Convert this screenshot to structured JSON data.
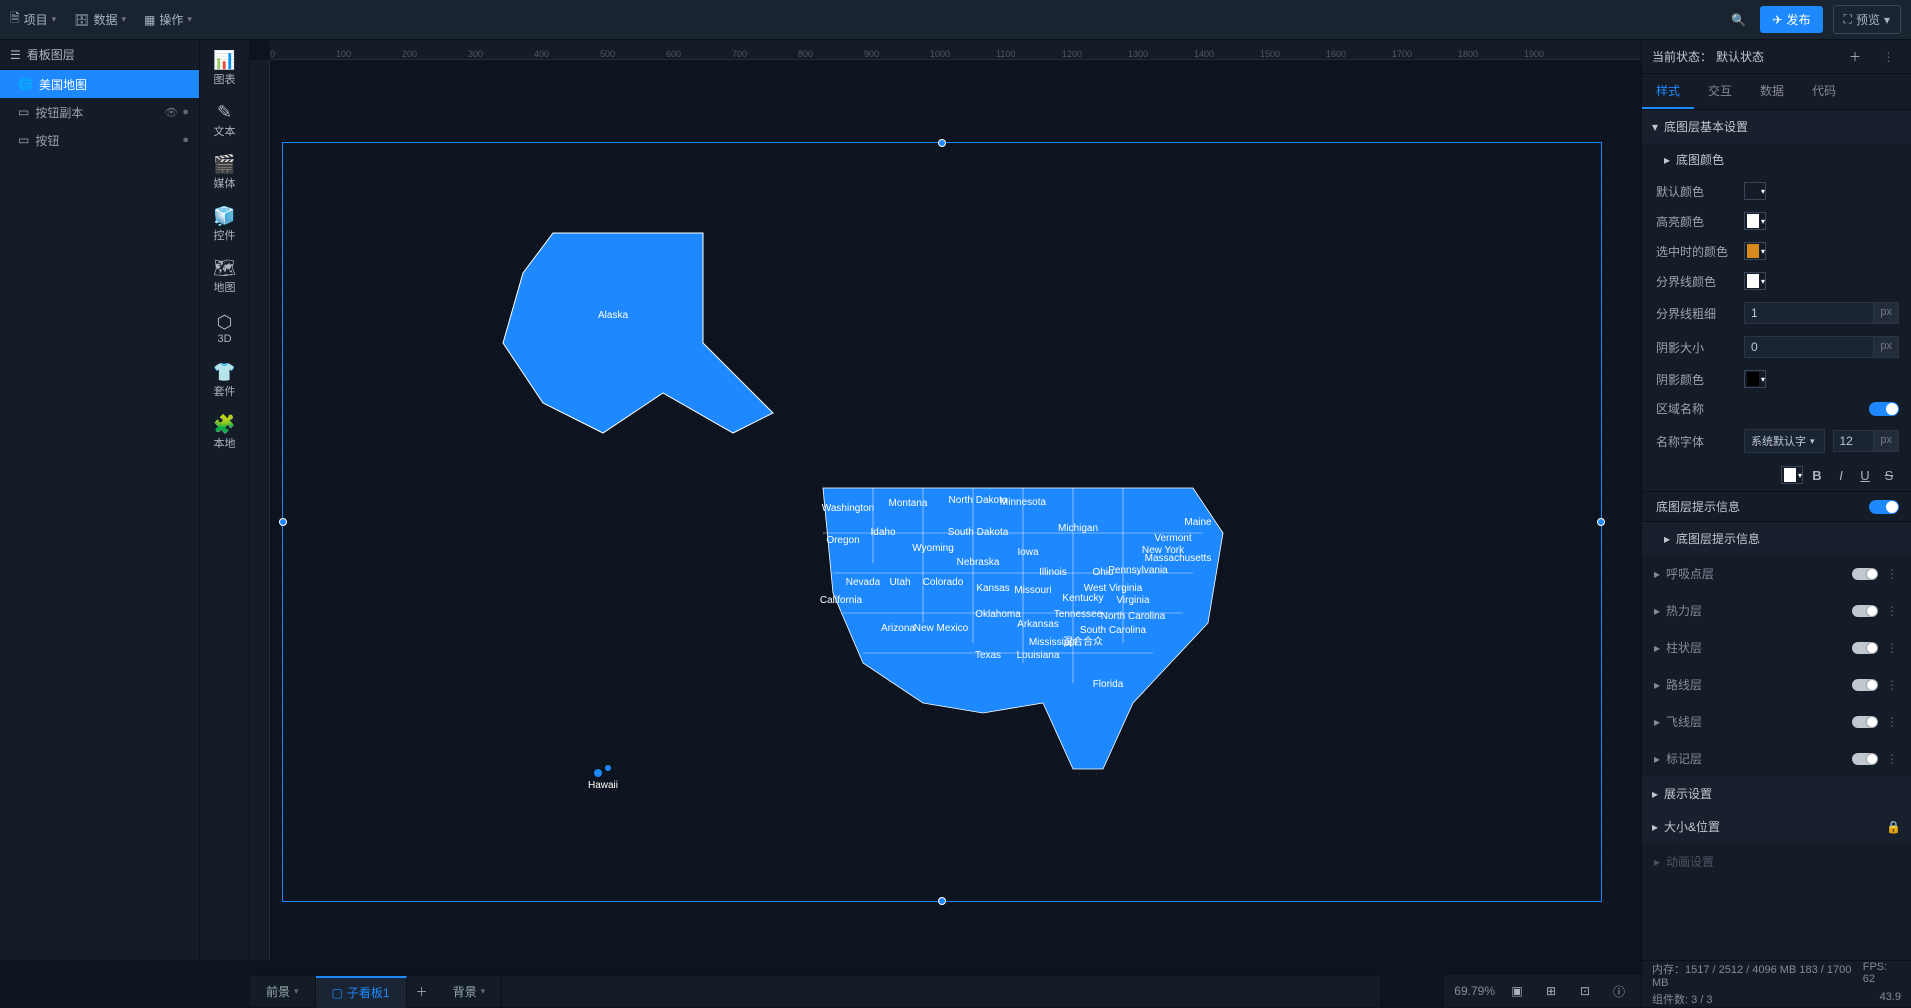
{
  "topbar": {
    "menu_project": "项目",
    "menu_data": "数据",
    "menu_operate": "操作",
    "publish": "发布",
    "preview": "预览"
  },
  "leftpanel": {
    "header": "看板图层",
    "layers": [
      {
        "name": "美国地图",
        "active": true
      },
      {
        "name": "按钮副本",
        "active": false,
        "has_icons": true
      },
      {
        "name": "按钮",
        "active": false,
        "has_icon": true
      }
    ]
  },
  "toolrail": [
    {
      "label": "图表"
    },
    {
      "label": "文本"
    },
    {
      "label": "媒体"
    },
    {
      "label": "控件"
    },
    {
      "label": "地图"
    },
    {
      "label": "3D"
    },
    {
      "label": "套件"
    },
    {
      "label": "本地"
    }
  ],
  "ruler_marks": [
    "0",
    "100",
    "200",
    "300",
    "400",
    "500",
    "600",
    "700",
    "800",
    "900",
    "1000",
    "1100",
    "1200",
    "1300",
    "1400",
    "1500",
    "1600",
    "1700",
    "1800",
    "1900"
  ],
  "map_states": [
    "Alaska",
    "Washington",
    "Montana",
    "North Dakota",
    "Minnesota",
    "Oregon",
    "Idaho",
    "South Dakota",
    "Michigan",
    "Wyoming",
    "Iowa",
    "Nebraska",
    "Illinois",
    "Ohio",
    "Pennsylvania",
    "Nevada",
    "Utah",
    "Colorado",
    "Kansas",
    "Missouri",
    "West Virginia",
    "California",
    "Kentucky",
    "Virginia",
    "Arizona",
    "New Mexico",
    "Oklahoma",
    "Arkansas",
    "Tennessee",
    "North Carolina",
    "South Carolina",
    "Texas",
    "Louisiana",
    "Mississippi",
    "混合合众",
    "Florida",
    "Maine",
    "Vermont",
    "New York",
    "Massachusetts",
    "Hawaii"
  ],
  "right": {
    "state_prefix": "当前状态：",
    "state_value": "默认状态",
    "tabs": [
      "样式",
      "交互",
      "数据",
      "代码"
    ],
    "section_base": "底图层基本设置",
    "section_base_color": "底图颜色",
    "p_default_color": "默认颜色",
    "p_highlight_color": "高亮颜色",
    "p_selected_color": "选中时的颜色",
    "p_border_color": "分界线颜色",
    "p_border_width": "分界线粗细",
    "p_border_width_val": "1",
    "p_shadow_size": "阴影大小",
    "p_shadow_size_val": "0",
    "p_shadow_color": "阴影颜色",
    "p_area_name": "区域名称",
    "p_name_font": "名称字体",
    "p_name_font_val": "系统默认字",
    "p_name_font_size": "12",
    "px": "px",
    "section_tooltip_toggle": "底图层提示信息",
    "section_tooltip": "底图层提示信息",
    "extra_layers": [
      "呼吸点层",
      "热力层",
      "柱状层",
      "路线层",
      "飞线层",
      "标记层"
    ],
    "section_display": "展示设置",
    "section_size": "大小&位置",
    "section_anim": "动画设置",
    "colors": {
      "default": "#1e88ff",
      "highlight": "#ffffff",
      "selected": "#d88a1e",
      "border": "#ffffff",
      "shadow": "#000000",
      "font": "#ffffff"
    }
  },
  "bottom": {
    "tab_front": "前景",
    "tab_sub": "子看板1",
    "tab_back": "背景",
    "zoom": "69.79%"
  },
  "status": {
    "mem_label": "内存：",
    "mem_value": "1517 / 2512 / 4096 MB  183 / 1700 MB",
    "comp_label": "组件数:",
    "comp_value": "3 / 3",
    "fps_label": "FPS:",
    "fps_value": "62",
    "fps2": "43.9"
  }
}
